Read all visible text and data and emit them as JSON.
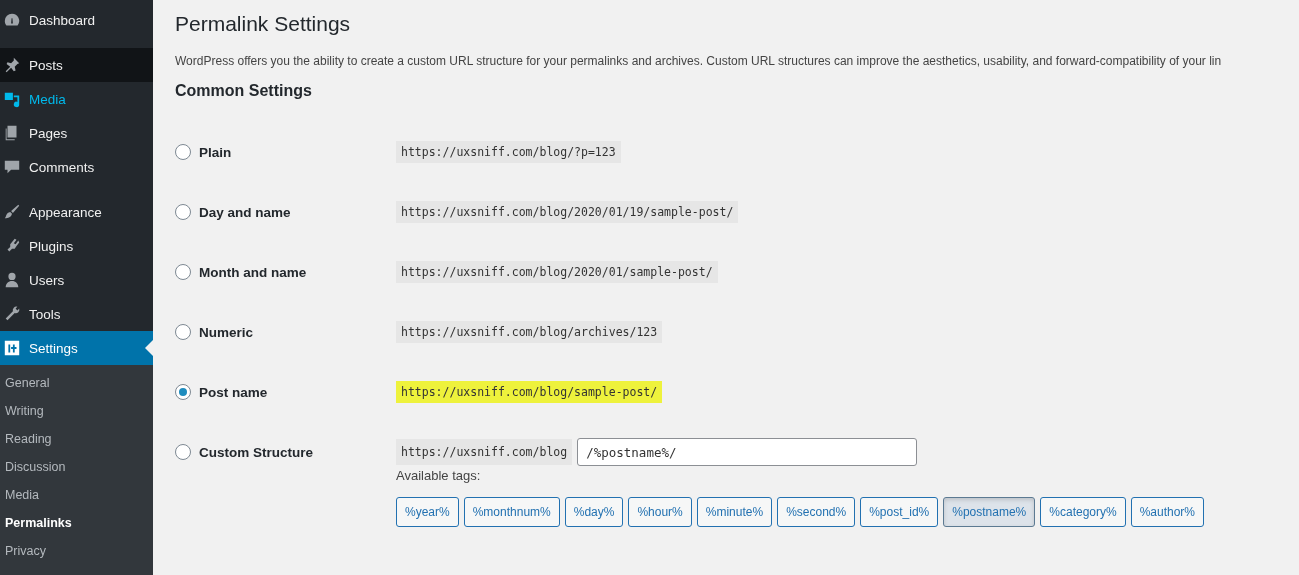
{
  "sidebar": {
    "items": [
      {
        "label": "Dashboard",
        "selected": false,
        "hovered": false,
        "highlighted": false
      },
      {
        "label": "Posts",
        "selected": false,
        "hovered": true,
        "highlighted": false
      },
      {
        "label": "Media",
        "selected": false,
        "hovered": false,
        "highlighted": true
      },
      {
        "label": "Pages",
        "selected": false,
        "hovered": false,
        "highlighted": false
      },
      {
        "label": "Comments",
        "selected": false,
        "hovered": false,
        "highlighted": false
      },
      {
        "label": "Appearance",
        "selected": false,
        "hovered": false,
        "highlighted": false
      },
      {
        "label": "Plugins",
        "selected": false,
        "hovered": false,
        "highlighted": false
      },
      {
        "label": "Users",
        "selected": false,
        "hovered": false,
        "highlighted": false
      },
      {
        "label": "Tools",
        "selected": false,
        "hovered": false,
        "highlighted": false
      },
      {
        "label": "Settings",
        "selected": true,
        "hovered": false,
        "highlighted": false
      }
    ],
    "submenu": [
      {
        "label": "General",
        "selected": false
      },
      {
        "label": "Writing",
        "selected": false
      },
      {
        "label": "Reading",
        "selected": false
      },
      {
        "label": "Discussion",
        "selected": false
      },
      {
        "label": "Media",
        "selected": false
      },
      {
        "label": "Permalinks",
        "selected": true
      },
      {
        "label": "Privacy",
        "selected": false
      }
    ]
  },
  "page": {
    "title": "Permalink Settings",
    "description": "WordPress offers you the ability to create a custom URL structure for your permalinks and archives. Custom URL structures can improve the aesthetics, usability, and forward-compatibility of your lin",
    "section_title": "Common Settings",
    "options": [
      {
        "kind": "example",
        "label": "Plain",
        "selected": false,
        "example": "https://uxsniff.com/blog/?p=123",
        "highlighted": false
      },
      {
        "kind": "example",
        "label": "Day and name",
        "selected": false,
        "example": "https://uxsniff.com/blog/2020/01/19/sample-post/",
        "highlighted": false
      },
      {
        "kind": "example",
        "label": "Month and name",
        "selected": false,
        "example": "https://uxsniff.com/blog/2020/01/sample-post/",
        "highlighted": false
      },
      {
        "kind": "example",
        "label": "Numeric",
        "selected": false,
        "example": "https://uxsniff.com/blog/archives/123",
        "highlighted": false
      },
      {
        "kind": "example",
        "label": "Post name",
        "selected": true,
        "example": "https://uxsniff.com/blog/sample-post/",
        "highlighted": true
      },
      {
        "kind": "custom",
        "label": "Custom Structure",
        "selected": false,
        "example": "https://uxsniff.com/blog",
        "value": "/%postname%/"
      }
    ],
    "tags_label": "Available tags:",
    "tags": [
      {
        "label": "%year%",
        "selected": false
      },
      {
        "label": "%monthnum%",
        "selected": false
      },
      {
        "label": "%day%",
        "selected": false
      },
      {
        "label": "%hour%",
        "selected": false
      },
      {
        "label": "%minute%",
        "selected": false
      },
      {
        "label": "%second%",
        "selected": false
      },
      {
        "label": "%post_id%",
        "selected": false
      },
      {
        "label": "%postname%",
        "selected": true
      },
      {
        "label": "%category%",
        "selected": false
      },
      {
        "label": "%author%",
        "selected": false
      }
    ]
  }
}
